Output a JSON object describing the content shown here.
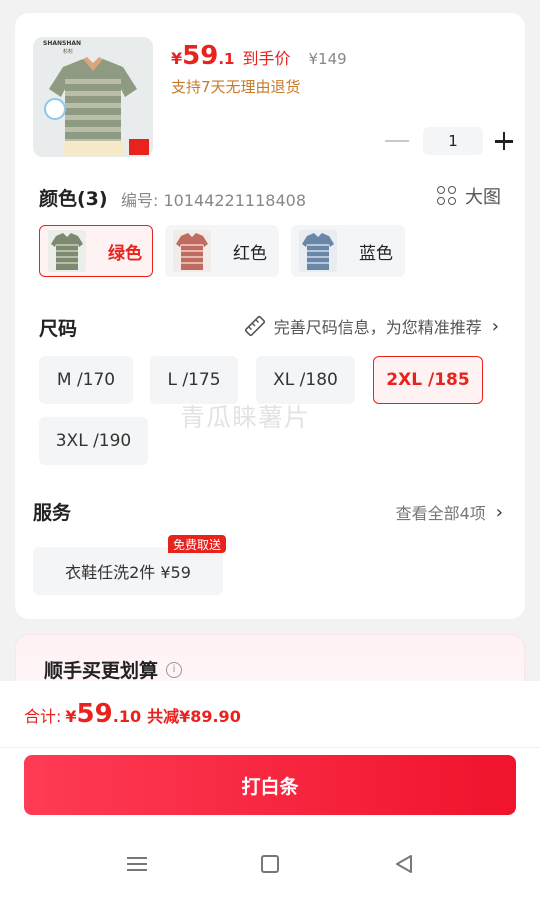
{
  "product": {
    "price_currency": "¥",
    "price_int": "59",
    "price_dec": ".1",
    "price_label": "到手价",
    "original_price": "¥149",
    "refund_policy": "支持7天无理由退货",
    "quantity": "1",
    "image_brand": "SHANSHAN",
    "image_sub": "杉杉"
  },
  "color_section": {
    "title": "颜色(3)",
    "code": "编号: 10144221118408",
    "big_image_label": "大图",
    "options": [
      {
        "label": "绿色",
        "selected": true,
        "stripe": "#7d8a6f"
      },
      {
        "label": "红色",
        "selected": false,
        "stripe": "#c06b5f"
      },
      {
        "label": "蓝色",
        "selected": false,
        "stripe": "#6a87a8"
      }
    ]
  },
  "size_section": {
    "title": "尺码",
    "hint": "完善尺码信息，为您精准推荐",
    "options": [
      {
        "label": "M /170",
        "selected": false
      },
      {
        "label": "L /175",
        "selected": false
      },
      {
        "label": "XL /180",
        "selected": false
      },
      {
        "label": "2XL /185",
        "selected": true
      },
      {
        "label": "3XL /190",
        "selected": false
      }
    ]
  },
  "watermark": "青瓜睐薯片",
  "service_section": {
    "title": "服务",
    "view_all": "查看全部4项",
    "item_label": "衣鞋任洗2件 ¥59",
    "badge": "免费取送"
  },
  "recommend": {
    "title": "顺手买更划算",
    "info": "i"
  },
  "footer": {
    "total_label": "合计:",
    "total_currency": "¥",
    "total_int": "59",
    "total_dec": ".10",
    "discount": "共减¥89.90",
    "pay_button": "打白条"
  },
  "colors": {
    "accent": "#e8231e",
    "refund": "#c87a2a"
  }
}
